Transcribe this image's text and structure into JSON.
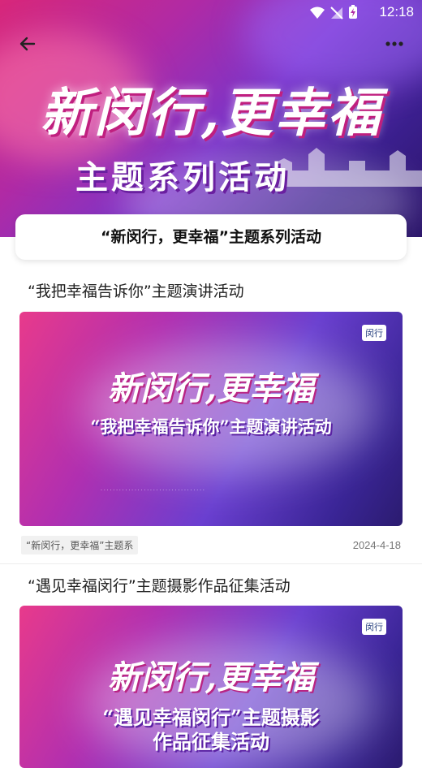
{
  "status_bar": {
    "time": "12:18"
  },
  "hero": {
    "title_main": "新闵行,更幸福",
    "title_sub": "主题系列活动"
  },
  "title_card": {
    "text": "“新闵行，更幸福”主题系列活动"
  },
  "articles": [
    {
      "title": "“我把幸福告诉你”主题演讲活动",
      "image_headline": "新闵行,更幸福",
      "image_sub": "“我把幸福告诉你”主题演讲活动",
      "image_logo": "闵行",
      "tag": "“新闵行，更幸福”主题系",
      "date": "2024-4-18"
    },
    {
      "title": "“遇见幸福闵行”主题摄影作品征集活动",
      "image_headline": "新闵行,更幸福",
      "image_sub_1": "“遇见幸福闵行”主题摄影",
      "image_sub_2": "作品征集活动",
      "image_logo": "闵行"
    }
  ],
  "icons": {
    "back": "arrow-left-icon",
    "more": "more-dots-icon",
    "wifi": "wifi-icon",
    "signal": "no-signal-icon",
    "battery": "battery-charging-icon"
  },
  "colors": {
    "accent_pink": "#d8277a",
    "accent_purple": "#7a35c9"
  }
}
